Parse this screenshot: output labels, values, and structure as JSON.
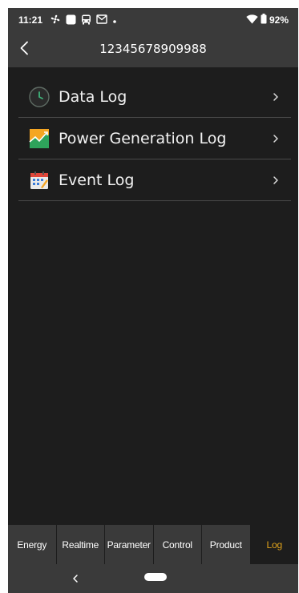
{
  "status_bar": {
    "time": "11:21",
    "battery": "92%",
    "icons_left": [
      "fan-icon",
      "square-icon",
      "bus-icon",
      "gmail-icon",
      "dot-icon"
    ],
    "icons_right": [
      "wifi-icon",
      "battery-icon"
    ]
  },
  "header": {
    "title": "12345678909988",
    "back_icon": "chevron-left-icon"
  },
  "menu": {
    "items": [
      {
        "label": "Data Log",
        "icon": "clock-icon"
      },
      {
        "label": "Power Generation Log",
        "icon": "chart-icon"
      },
      {
        "label": "Event Log",
        "icon": "calendar-icon"
      }
    ]
  },
  "tabs": {
    "items": [
      {
        "label": "Energy"
      },
      {
        "label": "Realtime"
      },
      {
        "label": "Parameter"
      },
      {
        "label": "Control"
      },
      {
        "label": "Product"
      },
      {
        "label": "Log"
      }
    ],
    "active": "Log",
    "active_color": "#e0a21a"
  },
  "nav_bar": {
    "back_icon": "nav-back-icon",
    "home_icon": "home-pill-icon"
  }
}
